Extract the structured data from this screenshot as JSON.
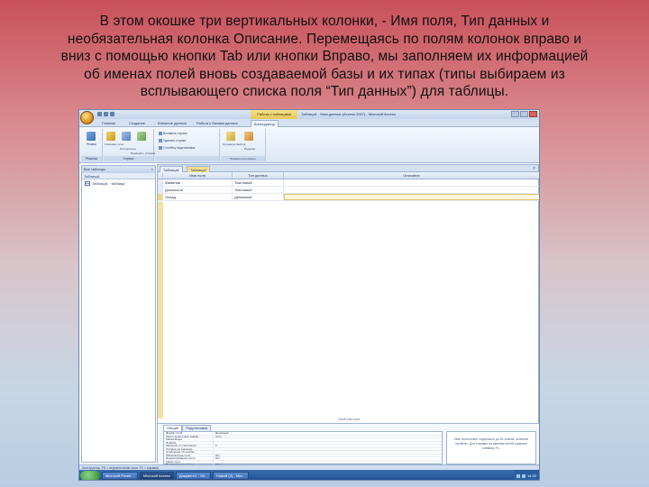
{
  "caption": {
    "lines": [
      "В этом окошке три вертикальных колонки, - Имя поля, Тип данных и",
      "необязательная колонка Описание. Перемещаясь по полям колонок вправо и",
      "вниз с помощью кнопки Tab или кнопки Вправо, мы заполняем их информацией",
      "об именах полей вновь создаваемой базы и их типах (типы выбираем из",
      "всплывающего списка поля “Тип данных”) для таблицы."
    ]
  },
  "access_window": {
    "title": "Таблица1 : база данных (Access 2007) - Microsoft Access",
    "contextual_tab": "Работа с таблицами",
    "ribbon_tabs": [
      "Главная",
      "Создание",
      "Внешние данные",
      "Работа с базами данных",
      "Конструктор"
    ],
    "ribbon_groups": [
      {
        "label": "Режимы",
        "commands": [
          "Режим"
        ]
      },
      {
        "label": "Сервис",
        "commands": [
          "Ключевое поле",
          "Построитель",
          "Проверить условия"
        ]
      },
      {
        "label": "",
        "commands": [
          "Вставить строки",
          "Удалить строки",
          "Столбец подстановок"
        ]
      },
      {
        "label": "Показать или скрыть",
        "commands": [
          "Страница свойств",
          "Индексы"
        ]
      }
    ],
    "nav_pane": {
      "header": "Все таблицы",
      "subheader": "Таблица1",
      "items": [
        "Таблица1 : таблица"
      ]
    },
    "doc_tabs": [
      "Таблица1",
      "Таблица2"
    ],
    "design_grid": {
      "columns": [
        "Имя поля",
        "Тип данных",
        "Описание"
      ],
      "rows": [
        {
          "name": "Фамилия",
          "type": "Текстовый",
          "desc": ""
        },
        {
          "name": "Должность",
          "type": "Текстовый",
          "desc": ""
        },
        {
          "name": "Оклад",
          "type": "Денежный",
          "desc": ""
        }
      ]
    },
    "divider_label": "Свойства поля",
    "properties": {
      "tabs": [
        "Общие",
        "Подстановка"
      ],
      "rows": [
        {
          "label": "Формат поля",
          "value": "Денежный"
        },
        {
          "label": "Число десятичных знаков",
          "value": "Авто"
        },
        {
          "label": "Маска ввода",
          "value": ""
        },
        {
          "label": "Подпись",
          "value": ""
        },
        {
          "label": "Значение по умолчанию",
          "value": "0"
        },
        {
          "label": "Условие на значение",
          "value": ""
        },
        {
          "label": "Сообщение об ошибке",
          "value": ""
        },
        {
          "label": "Обязательное поле",
          "value": "Нет"
        },
        {
          "label": "Индексированное поле",
          "value": "Нет"
        },
        {
          "label": "Смарт-теги",
          "value": ""
        },
        {
          "label": "Выравнивание текста",
          "value": "Общее"
        }
      ],
      "help": "Имя поля может содержать до 64 знаков, включая пробелы. Для справки по именам полей нажмите клавишу F1."
    },
    "status_text": "Конструктор. F6 = переключение окон. F1 = справка.",
    "taskbar": {
      "buttons": [
        "Microsoft Power...",
        "Microsoft Access",
        "Документ1 - Mi...",
        "Новый (2) - Micr..."
      ],
      "clock": "14:32"
    }
  }
}
